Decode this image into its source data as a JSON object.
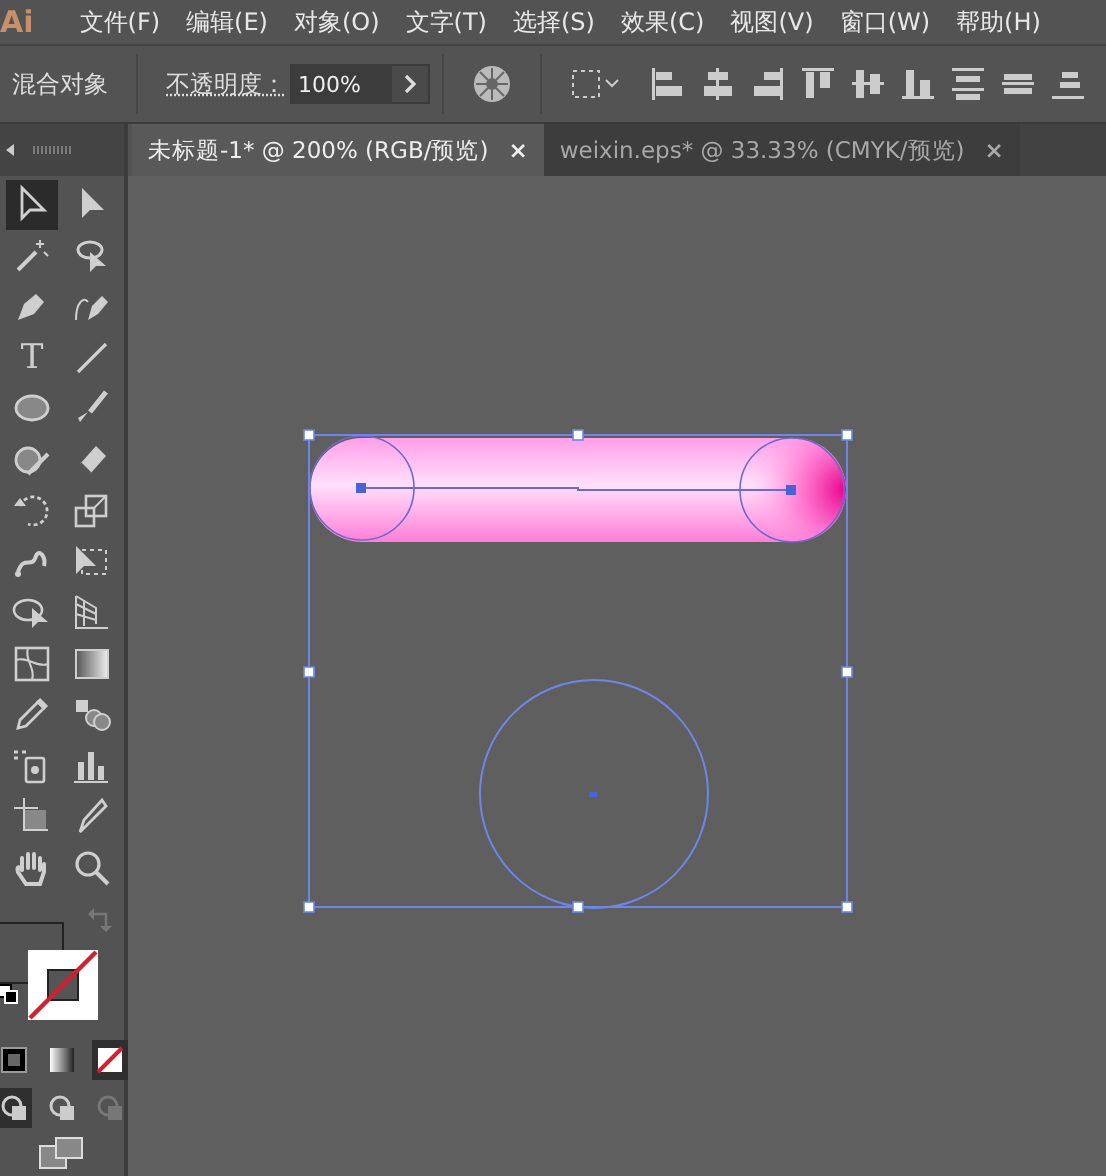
{
  "app_logo": "Ai",
  "menu": [
    "文件(F)",
    "编辑(E)",
    "对象(O)",
    "文字(T)",
    "选择(S)",
    "效果(C)",
    "视图(V)",
    "窗口(W)",
    "帮助(H)"
  ],
  "control_bar": {
    "selection_label": "混合对象",
    "opacity_label": "不透明度：",
    "opacity_value": "100%"
  },
  "tabs": [
    {
      "label": "未标题-1* @ 200% (RGB/预览)",
      "close": "×",
      "selected": true
    },
    {
      "label": "weixin.eps* @ 33.33% (CMYK/预览)",
      "close": "×",
      "selected": false
    }
  ],
  "tools": [
    {
      "kind": "selection",
      "selected": true
    },
    {
      "kind": "direct",
      "selected": false
    },
    {
      "kind": "wand",
      "selected": false
    },
    {
      "kind": "lasso",
      "selected": false
    },
    {
      "kind": "pen",
      "selected": false
    },
    {
      "kind": "curve",
      "selected": false
    },
    {
      "kind": "type",
      "glyph": "T",
      "selected": false
    },
    {
      "kind": "line",
      "selected": false
    },
    {
      "kind": "ellipse",
      "selected": false
    },
    {
      "kind": "brush",
      "selected": false
    },
    {
      "kind": "shaper",
      "selected": false
    },
    {
      "kind": "eraser",
      "selected": false
    },
    {
      "kind": "rotate",
      "selected": false
    },
    {
      "kind": "scale",
      "selected": false
    },
    {
      "kind": "puppet",
      "selected": false
    },
    {
      "kind": "transform",
      "selected": false
    },
    {
      "kind": "builder",
      "selected": false
    },
    {
      "kind": "perspective",
      "selected": false
    },
    {
      "kind": "mesh",
      "selected": false
    },
    {
      "kind": "gradient",
      "selected": false
    },
    {
      "kind": "eyedropper",
      "selected": false
    },
    {
      "kind": "blend",
      "selected": false
    },
    {
      "kind": "sprayer",
      "selected": false
    },
    {
      "kind": "graph",
      "selected": false
    },
    {
      "kind": "artboard",
      "selected": false
    },
    {
      "kind": "slice",
      "selected": false
    },
    {
      "kind": "hand",
      "selected": false
    },
    {
      "kind": "zoom",
      "selected": false
    }
  ],
  "color_modes": [
    {
      "kind": "color",
      "selected": false
    },
    {
      "kind": "gradient",
      "selected": false
    },
    {
      "kind": "none",
      "selected": true
    }
  ],
  "draw_modes": [
    {
      "selected": true
    },
    {
      "selected": false
    },
    {
      "selected": false
    }
  ]
}
